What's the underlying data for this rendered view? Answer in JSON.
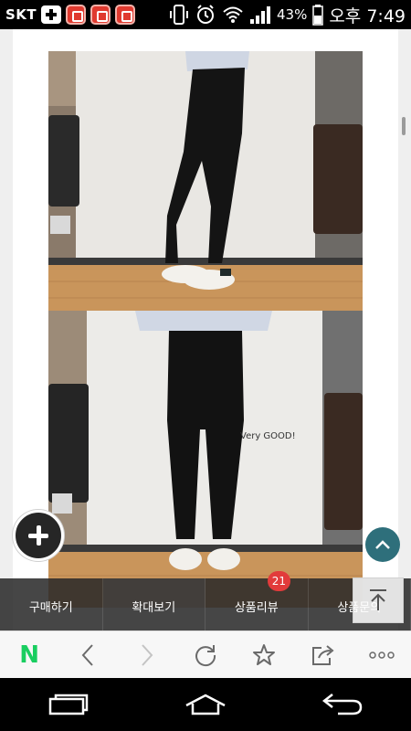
{
  "status_bar": {
    "carrier": "SKT",
    "notification_icons": [
      "plus-icon",
      "app-notification-icon",
      "app-notification-icon",
      "app-notification-icon"
    ],
    "battery_percent": "43%",
    "time": "오후 7:49"
  },
  "product_page": {
    "images": [
      "product-photo-side",
      "product-photo-front"
    ],
    "annotation_text": "Very GOOD!"
  },
  "tabs": [
    {
      "label": "구매하기"
    },
    {
      "label": "확대보기"
    },
    {
      "label": "상품리뷰",
      "badge": "21"
    },
    {
      "label": "상품문의",
      "badge": ""
    }
  ],
  "browser_toolbar": {
    "logo": "N",
    "items": [
      "back-icon",
      "forward-icon",
      "refresh-icon",
      "bookmark-star-icon",
      "share-icon",
      "more-icon"
    ]
  },
  "colors": {
    "accent_teal": "#2e6f7b",
    "badge_red": "#e23b3b",
    "naver_green": "#19ce60"
  }
}
